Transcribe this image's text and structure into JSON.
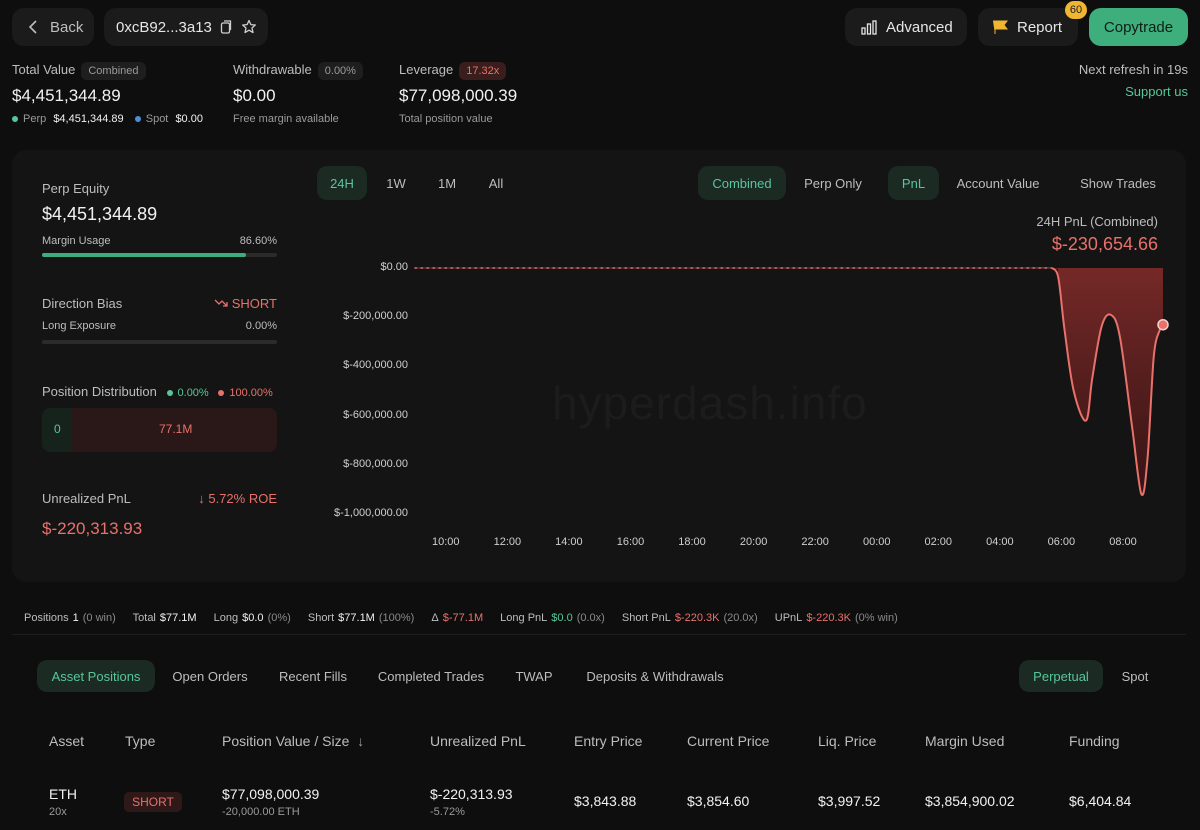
{
  "header": {
    "back_label": "Back",
    "address": "0xcB92...3a13",
    "advanced_label": "Advanced",
    "report_label": "Report",
    "report_badge": "60",
    "copytrade_label": "Copytrade"
  },
  "stats": {
    "total_value_label": "Total Value",
    "total_value_tag": "Combined",
    "total_value": "$4,451,344.89",
    "perp_label": "Perp",
    "perp_value": "$4,451,344.89",
    "spot_label": "Spot",
    "spot_value": "$0.00",
    "withdrawable_label": "Withdrawable",
    "withdrawable_tag": "0.00%",
    "withdrawable_value": "$0.00",
    "withdrawable_sub": "Free margin available",
    "leverage_label": "Leverage",
    "leverage_tag": "17.32x",
    "leverage_value": "$77,098,000.39",
    "leverage_sub": "Total position value",
    "refresh_text": "Next refresh in 19s",
    "support_link": "Support us"
  },
  "left_panel": {
    "perp_equity_label": "Perp Equity",
    "perp_equity_value": "$4,451,344.89",
    "margin_usage_label": "Margin Usage",
    "margin_usage_value": "86.60%",
    "margin_usage_fraction": 0.866,
    "direction_bias_label": "Direction Bias",
    "direction_bias_value": "SHORT",
    "long_exposure_label": "Long Exposure",
    "long_exposure_value": "0.00%",
    "position_distribution_label": "Position Distribution",
    "dist_long_pct": "0.00%",
    "dist_short_pct": "100.00%",
    "dist_long_value": "0",
    "dist_short_value": "77.1M",
    "unrealized_pnl_label": "Unrealized PnL",
    "roe_value": "5.72% ROE",
    "unrealized_pnl_value": "$-220,313.93"
  },
  "chart_controls": {
    "ranges": [
      "24H",
      "1W",
      "1M",
      "All"
    ],
    "active_range": "24H",
    "modes": [
      "Combined",
      "Perp Only"
    ],
    "active_mode": "Combined",
    "metrics": [
      "PnL",
      "Account Value"
    ],
    "active_metric": "PnL",
    "show_trades_label": "Show Trades",
    "pnl_title": "24H PnL (Combined)",
    "pnl_value": "$-230,654.66"
  },
  "chart_data": {
    "type": "area",
    "title": "24H PnL (Combined)",
    "xlabel": "",
    "ylabel": "",
    "x_ticks": [
      "10:00",
      "12:00",
      "14:00",
      "16:00",
      "18:00",
      "20:00",
      "22:00",
      "00:00",
      "02:00",
      "04:00",
      "06:00",
      "08:00"
    ],
    "y_ticks": [
      "$0.00",
      "$-200,000.00",
      "$-400,000.00",
      "$-600,000.00",
      "$-800,000.00",
      "$-1,000,000.00"
    ],
    "ylim": [
      -1000000,
      0
    ],
    "series": [
      {
        "x_hours": [
          9.0,
          16.0,
          22.0,
          28.0,
          29.7,
          29.9,
          30.1,
          30.4,
          30.8,
          31.0,
          31.3,
          31.6,
          31.9,
          32.3,
          32.6,
          32.8,
          33.0,
          33.2,
          33.3
        ],
        "values": [
          0,
          0,
          0,
          0,
          0,
          -40000,
          -250000,
          -500000,
          -620000,
          -450000,
          -240000,
          -190000,
          -280000,
          -650000,
          -920000,
          -770000,
          -360000,
          -250000,
          -230654.66
        ]
      }
    ],
    "color": "#e8716b",
    "watermark": "hyperdash.info"
  },
  "summary": {
    "positions_label": "Positions",
    "positions_value": "1",
    "positions_note": "(0 win)",
    "total_label": "Total",
    "total_value": "$77.1M",
    "long_label": "Long",
    "long_value": "$0.0",
    "long_note": "(0%)",
    "short_label": "Short",
    "short_value": "$77.1M",
    "short_note": "(100%)",
    "delta_label": "Δ",
    "delta_value": "$-77.1M",
    "long_pnl_label": "Long PnL",
    "long_pnl_value": "$0.0",
    "long_pnl_note": "(0.0x)",
    "short_pnl_label": "Short PnL",
    "short_pnl_value": "$-220.3K",
    "short_pnl_note": "(20.0x)",
    "upnl_label": "UPnL",
    "upnl_value": "$-220.3K",
    "upnl_note": "(0% win)"
  },
  "bottom_tabs": {
    "items": [
      "Asset Positions",
      "Open Orders",
      "Recent Fills",
      "Completed Trades",
      "TWAP",
      "Deposits & Withdrawals"
    ],
    "active": "Asset Positions",
    "market_tabs": [
      "Perpetual",
      "Spot"
    ],
    "active_market": "Perpetual"
  },
  "table": {
    "headers": [
      "Asset",
      "Type",
      "Position Value / Size",
      "Unrealized PnL",
      "Entry Price",
      "Current Price",
      "Liq. Price",
      "Margin Used",
      "Funding"
    ],
    "rows": [
      {
        "asset": "ETH",
        "leverage": "20x",
        "type": "SHORT",
        "position_value": "$77,098,000.39",
        "size": "-20,000.00 ETH",
        "unrealized_pnl": "$-220,313.93",
        "pnl_pct": "-5.72%",
        "entry_price": "$3,843.88",
        "current_price": "$3,854.60",
        "liq_price": "$3,997.52",
        "margin_used": "$3,854,900.02",
        "funding": "$6,404.84"
      }
    ]
  }
}
